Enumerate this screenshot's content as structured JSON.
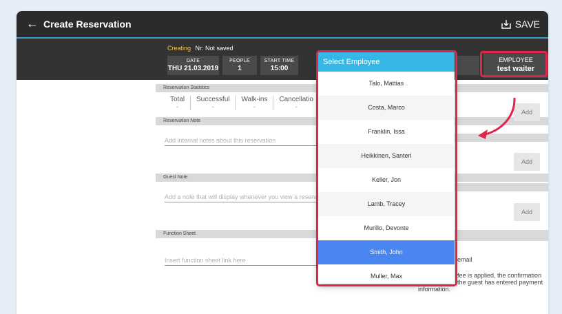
{
  "appbar": {
    "title": "Create Reservation",
    "save_label": "SAVE"
  },
  "status": {
    "creating": "Creating",
    "nr": "Nr: Not saved"
  },
  "chips": {
    "date": {
      "label": "DATE",
      "value": "THU 21.03.2019"
    },
    "people": {
      "label": "PEOPLE",
      "value": "1"
    },
    "start": {
      "label": "START TIME",
      "value": "15:00"
    },
    "employee": {
      "label": "EMPLOYEE",
      "value": "test waiter"
    }
  },
  "sections": {
    "statistics": "Reservation Statistics",
    "reservation_note": "Reservation Note",
    "guest_note": "Guest Note",
    "function_sheet": "Function Sheet"
  },
  "stats": [
    {
      "label": "Total",
      "value": "-"
    },
    {
      "label": "Successful",
      "value": "-"
    },
    {
      "label": "Walk-ins",
      "value": "-"
    },
    {
      "label": "Cancellatio",
      "value": "-"
    }
  ],
  "placeholders": {
    "reservation_note": "Add internal notes about this reservation",
    "guest_note": "Add a note that will display whenever you view a reservation",
    "function_sheet": "Insert function sheet link here"
  },
  "right_panel": {
    "add_label": "Add",
    "email_label": "email",
    "fee_text_1": "fee is applied, the confirmation",
    "fee_text_2": "the guest has entered payment",
    "fee_text_3": "information."
  },
  "popup": {
    "title": "Select Employee",
    "employees": [
      "Talo, Mattias",
      "Costa, Marco",
      "Franklin, Issa",
      "Heikkinen, Santeri",
      "Keller, Jon",
      "Lamb, Tracey",
      "Murillo, Devonte",
      "Smith, John",
      "Muller, Max"
    ],
    "selected_index": 7
  },
  "colors": {
    "highlight": "#e0244a",
    "popup_header": "#35b8e5",
    "selected": "#4a86f0",
    "appbar": "#2b2b2b"
  }
}
